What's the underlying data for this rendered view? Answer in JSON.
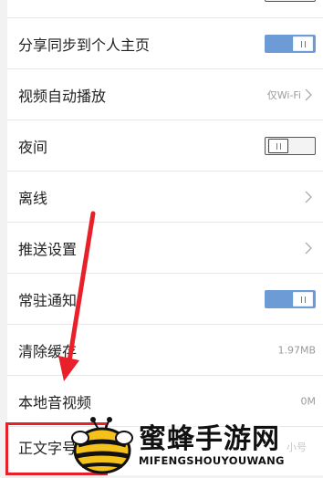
{
  "settings": {
    "top_partial": {
      "label": ""
    },
    "items": [
      {
        "label": "分享同步到个人主页",
        "toggle": "on"
      },
      {
        "label": "视频自动播放",
        "value": "仅Wi-Fi"
      },
      {
        "label": "夜间",
        "toggle": "off"
      },
      {
        "label": "离线"
      },
      {
        "label": "推送设置"
      },
      {
        "label": "常驻通知",
        "toggle": "on"
      },
      {
        "label": "清除缓存",
        "value": "1.97MB"
      },
      {
        "label": "本地音视频",
        "value": "0M"
      },
      {
        "label": "正文字号",
        "value": "小号"
      }
    ]
  },
  "watermark": {
    "title": "蜜蜂手游网",
    "subtitle": "MIFENGSHOUYOUWANG"
  },
  "colors": {
    "toggle_on": "#6d9bd6",
    "annotation_red": "#e8202a"
  }
}
